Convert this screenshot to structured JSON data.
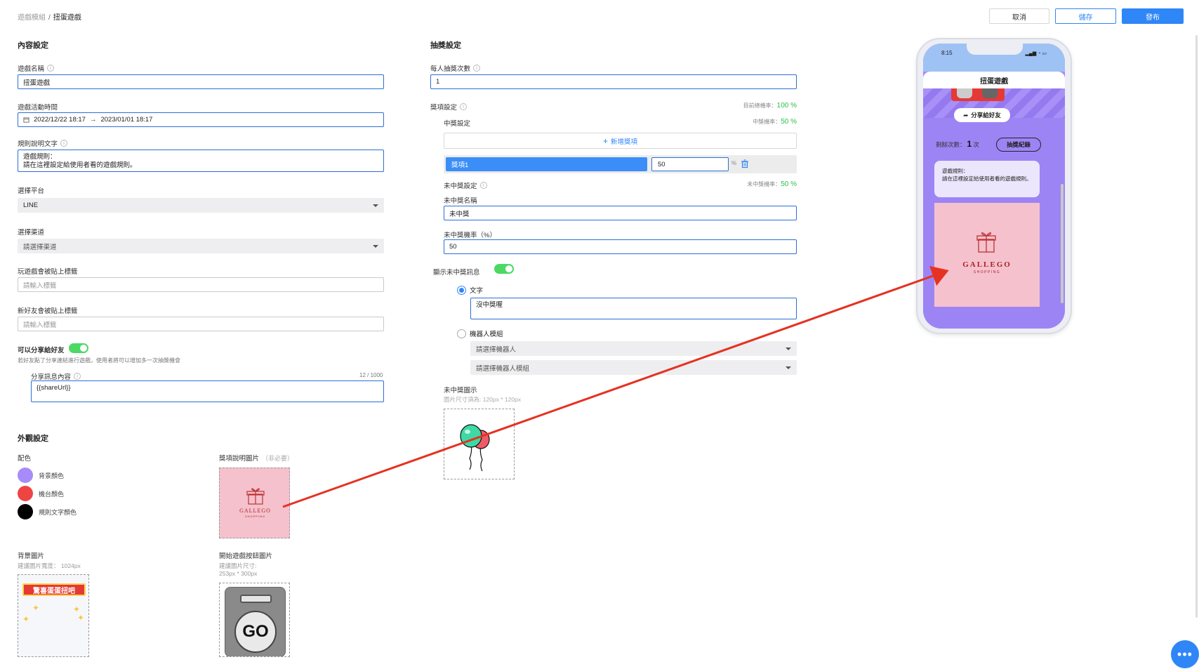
{
  "breadcrumb": {
    "parent": "遊戲模組",
    "separator": "/",
    "current": "扭蛋遊戲"
  },
  "header": {
    "cancel": "取消",
    "save": "儲存",
    "publish": "發布"
  },
  "content_settings": {
    "title": "內容設定",
    "game_name": {
      "label": "遊戲名稱",
      "value": "扭蛋遊戲"
    },
    "period": {
      "label": "遊戲活動時間",
      "start": "2022/12/22 18:17",
      "arrow": "→",
      "end": "2023/01/01 18:17"
    },
    "rules": {
      "label": "規則說明文字",
      "value": "遊戲規則：\n請在這裡設定給使用者看的遊戲規則。"
    },
    "platform": {
      "label": "選擇平台",
      "value": "LINE"
    },
    "channel": {
      "label": "選擇渠道",
      "placeholder": "請選擇渠道"
    },
    "play_tag": {
      "label": "玩遊戲會被貼上標籤",
      "placeholder": "請輸入標籤"
    },
    "friend_tag": {
      "label": "新好友會被貼上標籤",
      "placeholder": "請輸入標籤"
    },
    "share": {
      "label": "可以分享給好友",
      "hint": "若好友點了分享連結進行遊戲，使用者將可以增加多一次抽獎機會"
    },
    "share_message": {
      "label": "分享訊息內容",
      "counter": "12 / 1000",
      "value": "{{shareUrl}}"
    }
  },
  "appearance": {
    "title": "外觀設定",
    "colors_label": "配色",
    "colors": [
      {
        "name": "背景顏色",
        "hex": "#a78bfa"
      },
      {
        "name": "機台顏色",
        "hex": "#ef4444"
      },
      {
        "name": "規則文字顏色",
        "hex": "#000000"
      }
    ],
    "prize_image": {
      "label": "獎項說明圖片",
      "optional": "（非必要）"
    },
    "background_image": {
      "label": "背景圖片",
      "hint": "建議圖片寬度： 1024px",
      "banner_text": "驚喜蛋蛋扭吧"
    },
    "start_button_image": {
      "label": "開始遊戲按鈕圖片",
      "hint1": "建議圖片尺寸:",
      "hint2": "253px * 300px",
      "button_text": "GO"
    },
    "logo_main": "GALLEGO",
    "logo_sub": "SHOPPING"
  },
  "lottery": {
    "title": "抽獎設定",
    "draws": {
      "label": "每人抽獎次數",
      "value": "1"
    },
    "prize_settings": {
      "label": "獎項設定",
      "total_rate_label": "目前總機率：",
      "total_rate_value": "100 %"
    },
    "win": {
      "label": "中獎設定",
      "rate_label": "中獎機率：",
      "rate_value": "50 %",
      "add_prize": "新增獎項",
      "prize_name": "獎項1",
      "prize_rate": "50",
      "percent": "%"
    },
    "lose": {
      "label": "未中獎設定",
      "rate_label": "未中獎機率：",
      "rate_value": "50 %",
      "name_label": "未中獎名稱",
      "name_value": "未中獎",
      "rate_input_label": "未中獎機率（%）",
      "rate_input_value": "50",
      "show_message_label": "顯示未中獎訊息",
      "text_option": "文字",
      "text_value": "沒中獎喔",
      "bot_option": "機器人模組",
      "bot_placeholder": "請選擇機器人",
      "bot_module_placeholder": "請選擇機器人模組",
      "image_label": "未中獎圖示",
      "image_hint": "圖片尺寸須為: 120px * 120px"
    }
  },
  "preview": {
    "time": "8:15",
    "title": "扭蛋遊戲",
    "share_button": "分享給好友",
    "remaining_label": "剩餘次數：",
    "remaining_value": "1",
    "remaining_unit": "次",
    "history_button": "抽獎紀錄",
    "rules_text": "遊戲規則：\n請在這裡設定給使用者看的遊戲規則。"
  }
}
